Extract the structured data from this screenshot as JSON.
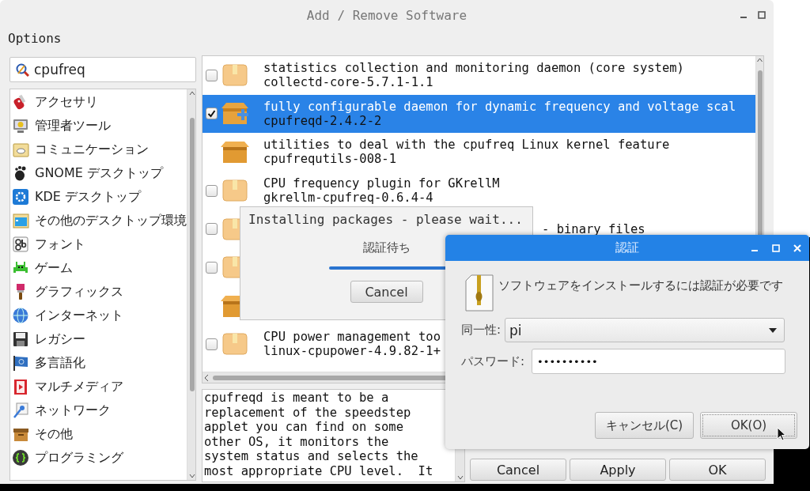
{
  "window": {
    "title": "Add / Remove Software"
  },
  "menu": [
    "Options"
  ],
  "search": {
    "value": "cpufreq"
  },
  "categories": [
    {
      "label": "アクセサリ"
    },
    {
      "label": "管理者ツール"
    },
    {
      "label": "コミュニケーション"
    },
    {
      "label": "GNOME デスクトップ"
    },
    {
      "label": "KDE デスクトップ"
    },
    {
      "label": "その他のデスクトップ環境"
    },
    {
      "label": "フォント"
    },
    {
      "label": "ゲーム"
    },
    {
      "label": "グラフィックス"
    },
    {
      "label": "インターネット"
    },
    {
      "label": "レガシー"
    },
    {
      "label": "多言語化"
    },
    {
      "label": "マルチメディア"
    },
    {
      "label": "ネットワーク"
    },
    {
      "label": "その他"
    },
    {
      "label": "プログラミング"
    }
  ],
  "packages": [
    {
      "kind": "available",
      "checked": false,
      "selected": false,
      "title": "statistics collection and monitoring daemon (core system)",
      "name": "collectd-core-5.7.1-1.1"
    },
    {
      "kind": "available",
      "checked": true,
      "selected": true,
      "title": "fully configurable daemon for dynamic frequency and voltage scal",
      "name": "cpufreqd-2.4.2-2"
    },
    {
      "kind": "installed",
      "selected": false,
      "title": "utilities to deal with the cpufreq Linux kernel feature",
      "name": "cpufrequtils-008-1"
    },
    {
      "kind": "available",
      "checked": false,
      "selected": false,
      "title": "CPU frequency plugin for GKrellM",
      "name": "gkrellm-cpufreq-0.6.4-4"
    },
    {
      "kind": "available",
      "checked": false,
      "selected": false,
      "covered": true,
      "title": "- binary files"
    },
    {
      "kind": "available",
      "checked": false,
      "selected": false
    },
    {
      "kind": "installed",
      "selected": false
    },
    {
      "kind": "available",
      "checked": false,
      "selected": false,
      "title": "CPU power management too",
      "name": "linux-cpupower-4.9.82-1+"
    }
  ],
  "description": "cpufreqd is meant to be a\nreplacement of the speedstep\napplet you can find on some\nother OS, it monitors the\nsystem status and selects the\nmost appropriate CPU level.  It",
  "buttons": [
    "Cancel",
    "Apply",
    "OK"
  ],
  "progress_dialog": {
    "title": "Installing packages - please wait...",
    "status": "認証待ち",
    "button": "Cancel"
  },
  "auth_dialog": {
    "title": "認証",
    "message": "ソフトウェアをインストールするには認証が必要です",
    "identity_label": "同一性:",
    "identity": "pi",
    "password_label": "パスワード:",
    "password": "••••••••••",
    "buttons": [
      "キャンセル(C)",
      "OK(O)"
    ]
  }
}
